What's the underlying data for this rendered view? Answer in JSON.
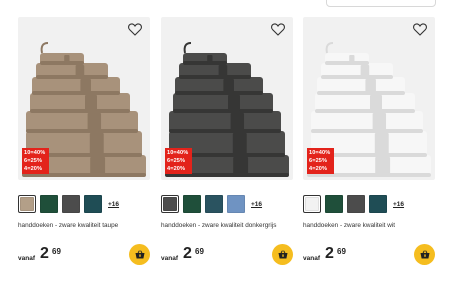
{
  "products": [
    {
      "name": "handdoeken - zware kwaliteit taupe",
      "price_prefix": "vanaf",
      "price_int": "2",
      "price_dec": "69",
      "promo": [
        "10=40%",
        "6=25%",
        "4=20%"
      ],
      "more_colors": "+16",
      "towel_color": "#a8927b",
      "towel_shade": "#8d7862",
      "swatches": [
        "#b39f88",
        "#1f4f3a",
        "#4c4c4c",
        "#1f4d55"
      ],
      "icons": {
        "favorite": "heart-icon",
        "cart": "basket-icon"
      }
    },
    {
      "name": "handdoeken - zware kwaliteit donkergrijs",
      "price_prefix": "vanaf",
      "price_int": "2",
      "price_dec": "69",
      "promo": [
        "10=40%",
        "6=25%",
        "4=20%"
      ],
      "more_colors": "+16",
      "towel_color": "#4b4b4a",
      "towel_shade": "#363635",
      "swatches": [
        "#4d4d4d",
        "#1f4f3a",
        "#2a5360",
        "#6f93c2"
      ],
      "icons": {
        "favorite": "heart-icon",
        "cart": "basket-icon"
      }
    },
    {
      "name": "handdoeken - zware kwaliteit wit",
      "price_prefix": "vanaf",
      "price_int": "2",
      "price_dec": "69",
      "promo": [
        "10=40%",
        "6=25%",
        "4=20%"
      ],
      "more_colors": "+16",
      "towel_color": "#f7f7f7",
      "towel_shade": "#dadada",
      "swatches": [
        "#f2f2f2",
        "#1f4f3a",
        "#4c4c4c",
        "#1f4d55"
      ],
      "icons": {
        "favorite": "heart-icon",
        "cart": "basket-icon"
      }
    }
  ],
  "colors": {
    "promo_bg": "#e3231b",
    "cart_bg": "#f5bd1f"
  }
}
